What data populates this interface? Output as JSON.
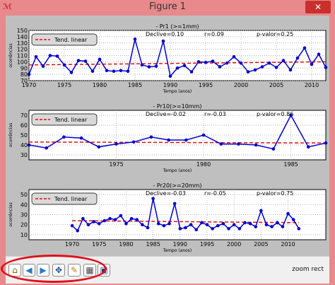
{
  "window": {
    "title": "Figure 1",
    "icon": "matplotlib-icon",
    "close_label": "✕"
  },
  "toolbar": {
    "tools": [
      {
        "name": "home-icon",
        "glyph": "⌂"
      },
      {
        "name": "back-icon",
        "glyph": "◀"
      },
      {
        "name": "forward-icon",
        "glyph": "▶"
      },
      {
        "name": "pan-icon",
        "glyph": "✥"
      },
      {
        "name": "zoom-icon",
        "glyph": "✎"
      },
      {
        "name": "subplots-icon",
        "glyph": "▦"
      },
      {
        "name": "save-icon",
        "glyph": "▣"
      }
    ],
    "status": "zoom rect"
  },
  "colors": {
    "series": "#0000cc",
    "trend": "#e01010",
    "annotation": "#e0101a",
    "window_frame": "#e8898c",
    "figure_bg": "#bfbfbf"
  },
  "chart_data": [
    {
      "type": "line",
      "title": "- Pr1 (>=1mm)",
      "stats": {
        "declive": "Declive=0.10",
        "r": "r=0.09",
        "p": "p-valor=0.25"
      },
      "ylabel": "ocorrências",
      "xlabel": "Tempo (anos)",
      "legend": "Tend. linear",
      "xlim": [
        1970,
        2012
      ],
      "ylim": [
        70,
        150
      ],
      "xticks": [
        1970,
        1975,
        1980,
        1985,
        1990,
        1995,
        2000,
        2005,
        2010
      ],
      "yticks": [
        70,
        80,
        90,
        100,
        110,
        120,
        130,
        140,
        150
      ],
      "x": [
        1970,
        1971,
        1972,
        1973,
        1974,
        1975,
        1976,
        1977,
        1978,
        1979,
        1980,
        1981,
        1982,
        1983,
        1984,
        1985,
        1986,
        1987,
        1988,
        1989,
        1990,
        1991,
        1992,
        1993,
        1994,
        1995,
        1996,
        1997,
        1998,
        1999,
        2000,
        2001,
        2002,
        2003,
        2004,
        2005,
        2006,
        2007,
        2008,
        2009,
        2010,
        2011,
        2012
      ],
      "values": [
        80,
        108,
        93,
        110,
        109,
        95,
        83,
        102,
        101,
        85,
        104,
        86,
        85,
        86,
        85,
        136,
        95,
        92,
        93,
        133,
        77,
        90,
        94,
        84,
        100,
        99,
        101,
        92,
        98,
        108,
        98,
        84,
        87,
        92,
        98,
        91,
        102,
        87,
        106,
        122,
        96,
        112,
        91
      ],
      "trend": [
        95,
        100
      ]
    },
    {
      "type": "line",
      "title": "- Pr10(>=10mm)",
      "stats": {
        "declive": "Declive=-0.02",
        "r": "r=-0.03",
        "p": "p-valor=0.86"
      },
      "ylabel": "ocorrências",
      "xlabel": "Tempo (anos)",
      "legend": "Tend. linear",
      "xlim": [
        1970,
        1987
      ],
      "ylim": [
        25,
        75
      ],
      "xticks": [
        1975,
        1980,
        1985
      ],
      "yticks": [
        30,
        40,
        50,
        60,
        70
      ],
      "x": [
        1970,
        1971,
        1972,
        1973,
        1974,
        1975,
        1976,
        1977,
        1978,
        1979,
        1980,
        1981,
        1982,
        1983,
        1984,
        1985,
        1986,
        1987
      ],
      "values": [
        40,
        37,
        48,
        47,
        38,
        41,
        43,
        48,
        45,
        45,
        50,
        41,
        41,
        40,
        36,
        70,
        38,
        42
      ],
      "trend": [
        43,
        42
      ]
    },
    {
      "type": "line",
      "title": "- Pr20(>=20mm)",
      "stats": {
        "declive": "Declive=-0.03",
        "r": "r=-0.05",
        "p": "p-valor=0.75"
      },
      "ylabel": "ocorrências",
      "xlabel": "Tempo (anos)",
      "legend": "Tend. linear",
      "xlim": [
        1962,
        2017
      ],
      "ylim": [
        5,
        55
      ],
      "xticks": [
        1970,
        1975,
        1980,
        1985,
        1990,
        1995,
        2000,
        2005,
        2010
      ],
      "yticks": [
        10,
        20,
        30,
        40,
        50
      ],
      "x": [
        1970,
        1971,
        1972,
        1973,
        1974,
        1975,
        1976,
        1977,
        1978,
        1979,
        1980,
        1981,
        1982,
        1983,
        1984,
        1985,
        1986,
        1987,
        1988,
        1989,
        1990,
        1991,
        1992,
        1993,
        1994,
        1995,
        1996,
        1997,
        1998,
        1999,
        2000,
        2001,
        2002,
        2003,
        2004,
        2005,
        2006,
        2007,
        2008,
        2009,
        2010,
        2011,
        2012
      ],
      "values": [
        19,
        14,
        26,
        20,
        23,
        21,
        24,
        26,
        25,
        29,
        21,
        26,
        25,
        20,
        17,
        46,
        21,
        19,
        21,
        41,
        16,
        17,
        20,
        15,
        22,
        20,
        16,
        19,
        21,
        16,
        20,
        16,
        22,
        21,
        18,
        34,
        20,
        18,
        22,
        18,
        31,
        25,
        16
      ],
      "trend": [
        24,
        22
      ]
    }
  ]
}
